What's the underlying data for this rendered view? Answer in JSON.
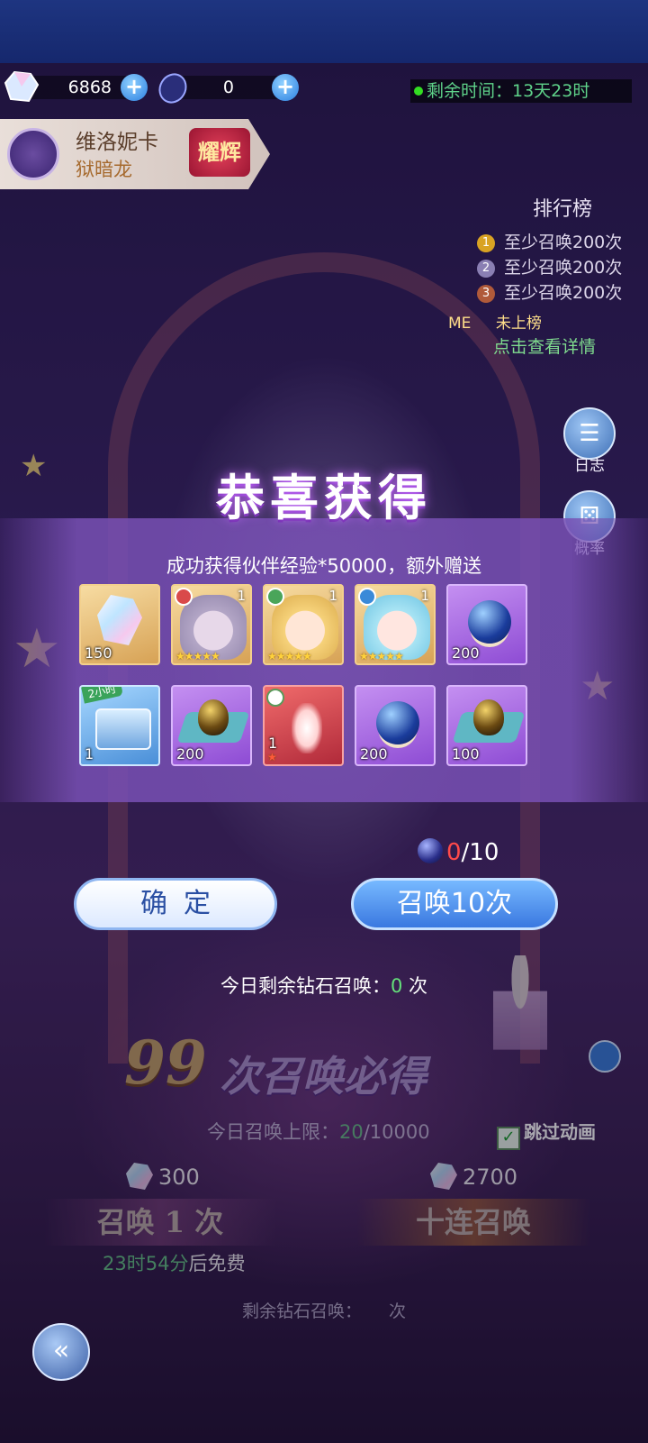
{
  "hud": {
    "diamond_amount": "6868",
    "gem_amount": "0",
    "timer_label": "剩余时间：13天23时"
  },
  "hero": {
    "name": "维洛妮卡",
    "title": "狱暗龙",
    "tag": "耀辉"
  },
  "ranking": {
    "title": "排行榜",
    "rows": [
      {
        "rank": "1",
        "text": "至少召唤200次"
      },
      {
        "rank": "2",
        "text": "至少召唤200次"
      },
      {
        "rank": "3",
        "text": "至少召唤200次"
      }
    ],
    "me_badge": "ME",
    "me_text": "未上榜",
    "view_details": "点击查看详情"
  },
  "side_buttons": {
    "log_label": "日志",
    "probability_label": "概率"
  },
  "reward_modal": {
    "title": "恭喜获得",
    "subtitle": "成功获得伙伴经验*50000，额外赠送",
    "items": [
      {
        "type": "crystal",
        "qty": "150"
      },
      {
        "type": "hero",
        "level": "1",
        "stars": "★★★★★"
      },
      {
        "type": "hero",
        "level": "1",
        "stars": "★★★★★"
      },
      {
        "type": "hero",
        "level": "1",
        "stars": "★★★★★"
      },
      {
        "type": "orb",
        "qty": "200"
      },
      {
        "type": "chest",
        "qty": "1",
        "tag": "2小时"
      },
      {
        "type": "egg",
        "qty": "200"
      },
      {
        "type": "fairy",
        "qty": "1",
        "stars": "★"
      },
      {
        "type": "orb",
        "qty": "200"
      },
      {
        "type": "egg",
        "qty": "100"
      }
    ],
    "gem_count_current": "0",
    "gem_count_total": "/10",
    "confirm_label": "确定",
    "summon10_label": "召唤10次",
    "daily_left_prefix": "今日剩余钻石召唤：",
    "daily_left_value": "0",
    "daily_left_suffix": " 次"
  },
  "background": {
    "pity_number": "99",
    "pity_text": "次召唤必得",
    "limit_prefix": "今日召唤上限：",
    "limit_current": "20",
    "limit_total": "/10000",
    "skip_label": "跳过动画",
    "cost_one": "300",
    "cost_ten": "2700",
    "summon_one_label": "召唤 1 次",
    "summon_ten_label": "十连召唤",
    "free_time": "23时54分",
    "free_suffix": "后免费",
    "remain_prefix": "剩余钻石召唤：",
    "remain_suffix": "次"
  },
  "colors": {
    "accent_blue": "#3a78e0",
    "timer_green": "#5fd38a",
    "counter_red": "#ff4a4a",
    "modal_purple": "#784fb4"
  }
}
